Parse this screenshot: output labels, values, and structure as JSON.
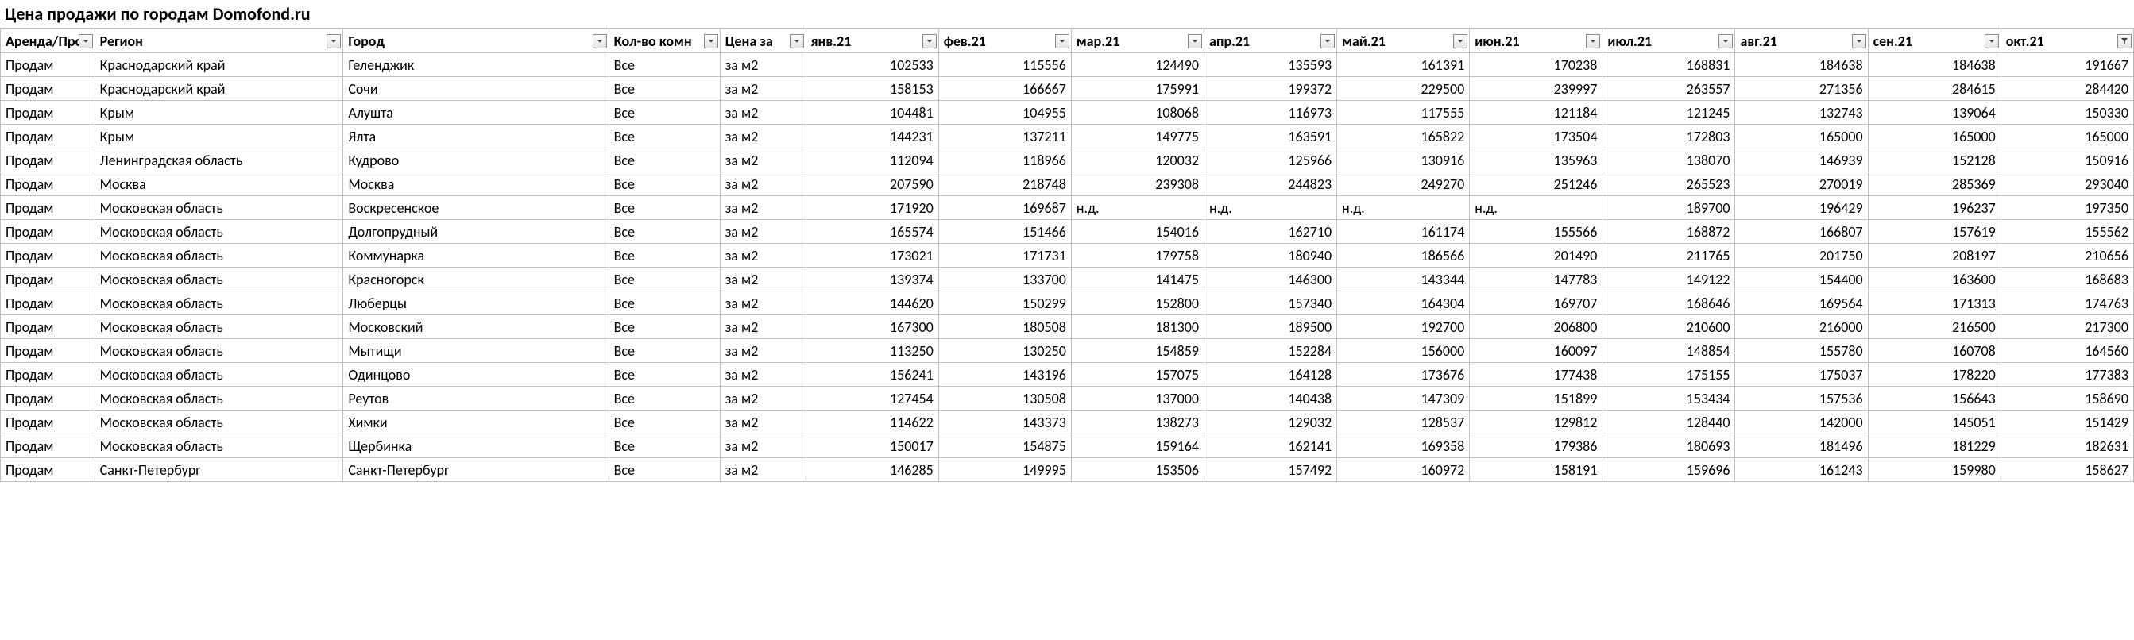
{
  "title": "Цена продажи по городам Domofond.ru",
  "headers": {
    "type": "Аренда/Прод",
    "region": "Регион",
    "city": "Город",
    "rooms": "Кол-во комн",
    "per": "Цена за",
    "months": [
      "янв.21",
      "фев.21",
      "мар.21",
      "апр.21",
      "май.21",
      "июн.21",
      "июл.21",
      "авг.21",
      "сен.21",
      "окт.21"
    ]
  },
  "rows": [
    {
      "type": "Продам",
      "region": "Краснодарский край",
      "city": "Геленджик",
      "rooms": "Все",
      "per": "за м2",
      "v": [
        "102533",
        "115556",
        "124490",
        "135593",
        "161391",
        "170238",
        "168831",
        "184638",
        "184638",
        "191667"
      ]
    },
    {
      "type": "Продам",
      "region": "Краснодарский край",
      "city": "Сочи",
      "rooms": "Все",
      "per": "за м2",
      "v": [
        "158153",
        "166667",
        "175991",
        "199372",
        "229500",
        "239997",
        "263557",
        "271356",
        "284615",
        "284420"
      ]
    },
    {
      "type": "Продам",
      "region": "Крым",
      "city": "Алушта",
      "rooms": "Все",
      "per": "за м2",
      "v": [
        "104481",
        "104955",
        "108068",
        "116973",
        "117555",
        "121184",
        "121245",
        "132743",
        "139064",
        "150330"
      ]
    },
    {
      "type": "Продам",
      "region": "Крым",
      "city": "Ялта",
      "rooms": "Все",
      "per": "за м2",
      "v": [
        "144231",
        "137211",
        "149775",
        "163591",
        "165822",
        "173504",
        "172803",
        "165000",
        "165000",
        "165000"
      ]
    },
    {
      "type": "Продам",
      "region": "Ленинградская область",
      "city": "Кудрово",
      "rooms": "Все",
      "per": "за м2",
      "v": [
        "112094",
        "118966",
        "120032",
        "125966",
        "130916",
        "135963",
        "138070",
        "146939",
        "152128",
        "150916"
      ]
    },
    {
      "type": "Продам",
      "region": "Москва",
      "city": "Москва",
      "rooms": "Все",
      "per": "за м2",
      "v": [
        "207590",
        "218748",
        "239308",
        "244823",
        "249270",
        "251246",
        "265523",
        "270019",
        "285369",
        "293040"
      ]
    },
    {
      "type": "Продам",
      "region": "Московская область",
      "city": "Воскресенское",
      "rooms": "Все",
      "per": "за м2",
      "v": [
        "171920",
        "169687",
        "н.д.",
        "н.д.",
        "н.д.",
        "н.д.",
        "189700",
        "196429",
        "196237",
        "197350"
      ]
    },
    {
      "type": "Продам",
      "region": "Московская область",
      "city": "Долгопрудный",
      "rooms": "Все",
      "per": "за м2",
      "v": [
        "165574",
        "151466",
        "154016",
        "162710",
        "161174",
        "155566",
        "168872",
        "166807",
        "157619",
        "155562"
      ]
    },
    {
      "type": "Продам",
      "region": "Московская область",
      "city": "Коммунарка",
      "rooms": "Все",
      "per": "за м2",
      "v": [
        "173021",
        "171731",
        "179758",
        "180940",
        "186566",
        "201490",
        "211765",
        "201750",
        "208197",
        "210656"
      ]
    },
    {
      "type": "Продам",
      "region": "Московская область",
      "city": "Красногорск",
      "rooms": "Все",
      "per": "за м2",
      "v": [
        "139374",
        "133700",
        "141475",
        "146300",
        "143344",
        "147783",
        "149122",
        "154400",
        "163600",
        "168683"
      ]
    },
    {
      "type": "Продам",
      "region": "Московская область",
      "city": "Люберцы",
      "rooms": "Все",
      "per": "за м2",
      "v": [
        "144620",
        "150299",
        "152800",
        "157340",
        "164304",
        "169707",
        "168646",
        "169564",
        "171313",
        "174763"
      ]
    },
    {
      "type": "Продам",
      "region": "Московская область",
      "city": "Московский",
      "rooms": "Все",
      "per": "за м2",
      "v": [
        "167300",
        "180508",
        "181300",
        "189500",
        "192700",
        "206800",
        "210600",
        "216000",
        "216500",
        "217300"
      ]
    },
    {
      "type": "Продам",
      "region": "Московская область",
      "city": "Мытищи",
      "rooms": "Все",
      "per": "за м2",
      "v": [
        "113250",
        "130250",
        "154859",
        "152284",
        "156000",
        "160097",
        "148854",
        "155780",
        "160708",
        "164560"
      ]
    },
    {
      "type": "Продам",
      "region": "Московская область",
      "city": "Одинцово",
      "rooms": "Все",
      "per": "за м2",
      "v": [
        "156241",
        "143196",
        "157075",
        "164128",
        "173676",
        "177438",
        "175155",
        "175037",
        "178220",
        "177383"
      ]
    },
    {
      "type": "Продам",
      "region": "Московская область",
      "city": "Реутов",
      "rooms": "Все",
      "per": "за м2",
      "v": [
        "127454",
        "130508",
        "137000",
        "140438",
        "147309",
        "151899",
        "153434",
        "157536",
        "156643",
        "158690"
      ]
    },
    {
      "type": "Продам",
      "region": "Московская область",
      "city": "Химки",
      "rooms": "Все",
      "per": "за м2",
      "v": [
        "114622",
        "143373",
        "138273",
        "129032",
        "128537",
        "129812",
        "128440",
        "142000",
        "145051",
        "151429"
      ]
    },
    {
      "type": "Продам",
      "region": "Московская область",
      "city": "Щербинка",
      "rooms": "Все",
      "per": "за м2",
      "v": [
        "150017",
        "154875",
        "159164",
        "162141",
        "169358",
        "179386",
        "180693",
        "181496",
        "181229",
        "182631"
      ]
    },
    {
      "type": "Продам",
      "region": "Санкт-Петербург",
      "city": "Санкт-Петербург",
      "rooms": "Все",
      "per": "за м2",
      "v": [
        "146285",
        "149995",
        "153506",
        "157492",
        "160972",
        "158191",
        "159696",
        "161243",
        "159980",
        "158627"
      ]
    }
  ]
}
